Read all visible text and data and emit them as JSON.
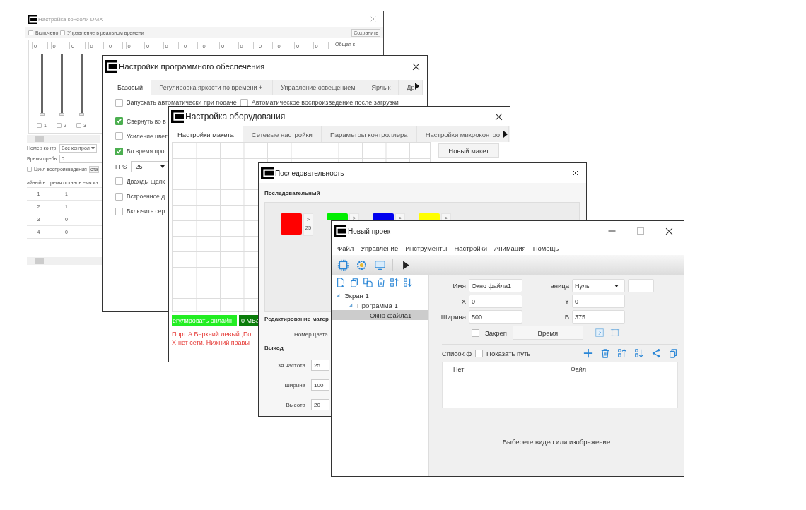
{
  "dmx_window": {
    "title": "Настройка консоли DMX",
    "options": [
      {
        "label": "Включено",
        "checked": false
      },
      {
        "label": "Управление в реальном времени",
        "checked": false
      }
    ],
    "save_button": "Сохранить",
    "channel_values": [
      "0",
      "0",
      "0",
      "0",
      "0",
      "0",
      "0",
      "0",
      "0",
      "0",
      "0",
      "0",
      "0",
      "0",
      "0",
      "0"
    ],
    "master_label": "Общая к",
    "sliders": [
      {
        "label": "1",
        "checked": false,
        "level": 0
      },
      {
        "label": "2",
        "checked": false,
        "level": 0
      },
      {
        "label": "3",
        "checked": false,
        "level": 0
      }
    ],
    "controller_label": "Номер контр",
    "controller_select": "Все контрол",
    "delay_label": "Время пребь",
    "delay_value": "0",
    "loop": {
      "label": "Цикл воспроизведения",
      "checked": false
    },
    "loop_button": "ста",
    "table": {
      "columns": [
        "айный н",
        "ремя останов",
        "емя из"
      ],
      "rows": [
        [
          "1",
          "1"
        ],
        [
          "2",
          "1"
        ],
        [
          "3",
          "0"
        ],
        [
          "4",
          "0"
        ]
      ]
    }
  },
  "software_window": {
    "title": "Настройки программного обеспечения",
    "tabs": [
      {
        "label": "Базовый",
        "selected": true
      },
      {
        "label": "Регулировка яркости по времени +-",
        "selected": false
      },
      {
        "label": "Управление освещением",
        "selected": false
      },
      {
        "label": "Ярлык",
        "selected": false
      },
      {
        "label": "Др",
        "selected": false
      }
    ],
    "top_options": [
      {
        "label": "Запускать автоматически при подаче",
        "checked": false
      },
      {
        "label": "Автоматическое воспроизведение после загрузки",
        "checked": false
      }
    ],
    "settings": [
      {
        "kind": "checkbox",
        "label": "Свернуть во в",
        "checked": true
      },
      {
        "kind": "checkbox",
        "label": "Усиление цвет",
        "checked": false
      },
      {
        "kind": "checkbox",
        "label": "Во время про",
        "checked": true
      },
      {
        "kind": "select",
        "label": "FPS",
        "value": "25"
      },
      {
        "kind": "checkbox",
        "label": "Дважды щелк",
        "checked": false
      },
      {
        "kind": "checkbox",
        "label": "Встроенное д",
        "checked": false
      },
      {
        "kind": "checkbox",
        "label": "Включить сер",
        "checked": false
      }
    ]
  },
  "hardware_window": {
    "title": "Настройка оборудования",
    "tabs": [
      {
        "label": "Настройки макета",
        "selected": true
      },
      {
        "label": "Сетевые настройки",
        "selected": false
      },
      {
        "label": "Параметры контроллера",
        "selected": false
      },
      {
        "label": "Настройки микроконтро",
        "selected": false
      }
    ],
    "new_layout_button": "Новый макет",
    "online_button": "егулировать онлайн",
    "size_badge": "0 МБа",
    "status_lines": [
      "Порт А:Верхний левый ;По",
      "Х-нет сети. Нижний правы"
    ]
  },
  "sequence_window": {
    "title": "Последовательность",
    "section": "Последовательный",
    "colors": [
      {
        "color": "#ff0000",
        "step": ">",
        "value": "25"
      },
      {
        "color": "#00ee00",
        "step": ">"
      },
      {
        "color": "#0000ee",
        "step": ">"
      },
      {
        "color": "#ffff00",
        "step": ">"
      }
    ],
    "edit_label": "Редактирование матер",
    "color_number_label": "Номер цвета",
    "output_label": "Выход",
    "fields": [
      {
        "label": "зя частота",
        "value": "25"
      },
      {
        "label": "Ширина",
        "value": "100"
      },
      {
        "label": "Высота",
        "value": "20"
      }
    ]
  },
  "project_window": {
    "title": "Новый проект",
    "menu": [
      "Файл",
      "Управление",
      "Инструменты",
      "Настройки",
      "Анимация",
      "Помощь"
    ],
    "tree": [
      {
        "label": "Экран 1",
        "expanded": true,
        "selected": false,
        "children": [
          {
            "label": "Программа 1",
            "expanded": true,
            "selected": false,
            "children": [
              {
                "label": "Окно файла1",
                "selected": true
              }
            ]
          }
        ]
      }
    ],
    "form": {
      "name_label": "Имя",
      "name_value": "Окно файла1",
      "border_label": "аница",
      "border_value": "Нуль",
      "x_label": "X",
      "x_value": "0",
      "y_label": "Y",
      "y_value": "0",
      "width_label": "Ширина",
      "width_value": "500",
      "height_label": "В",
      "height_value": "375",
      "pin": {
        "label": "Закреп",
        "checked": false
      },
      "time_button": "Время"
    },
    "file_list": {
      "label": "Список ф",
      "show_path": {
        "label": "Показать путь",
        "checked": false
      },
      "columns": [
        "Нет",
        "Файл"
      ]
    },
    "hint": "Выберете видео или изображение"
  }
}
